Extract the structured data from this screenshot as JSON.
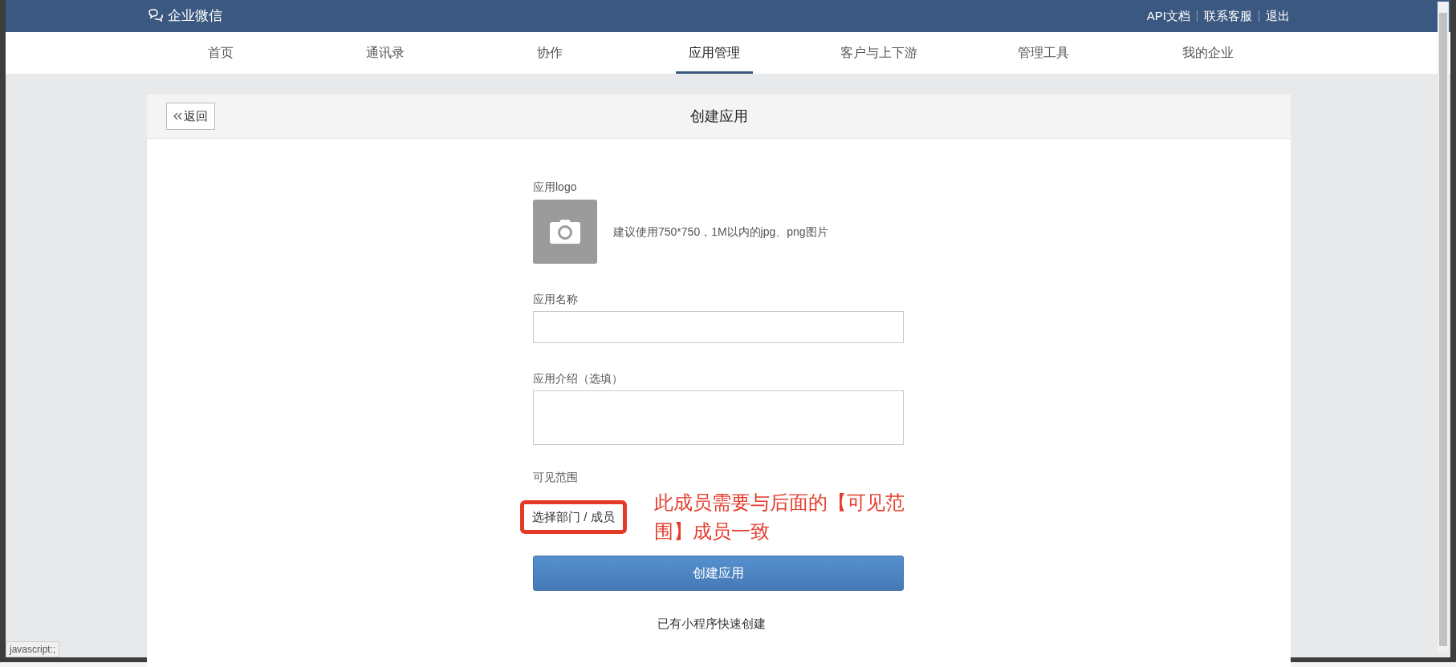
{
  "header": {
    "brand": "企业微信",
    "links": [
      "API文档",
      "联系客服",
      "退出"
    ]
  },
  "nav": {
    "tabs": [
      {
        "label": "首页",
        "selected": false
      },
      {
        "label": "通讯录",
        "selected": false
      },
      {
        "label": "协作",
        "selected": false
      },
      {
        "label": "应用管理",
        "selected": true
      },
      {
        "label": "客户与上下游",
        "selected": false
      },
      {
        "label": "管理工具",
        "selected": false
      },
      {
        "label": "我的企业",
        "selected": false
      }
    ]
  },
  "card": {
    "back_button": "返回",
    "title": "创建应用"
  },
  "form": {
    "logo_label": "应用logo",
    "logo_hint": "建议使用750*750，1M以内的jpg、png图片",
    "name_label": "应用名称",
    "intro_label": "应用介绍（选填）",
    "visibility_label": "可见范围",
    "visibility_link": "选择部门 / 成员",
    "annotation": "此成员需要与后面的【可见范围】成员一致",
    "submit_button": "创建应用",
    "mini_program_link": "已有小程序快速创建"
  },
  "status_bar": "javascript:;"
}
